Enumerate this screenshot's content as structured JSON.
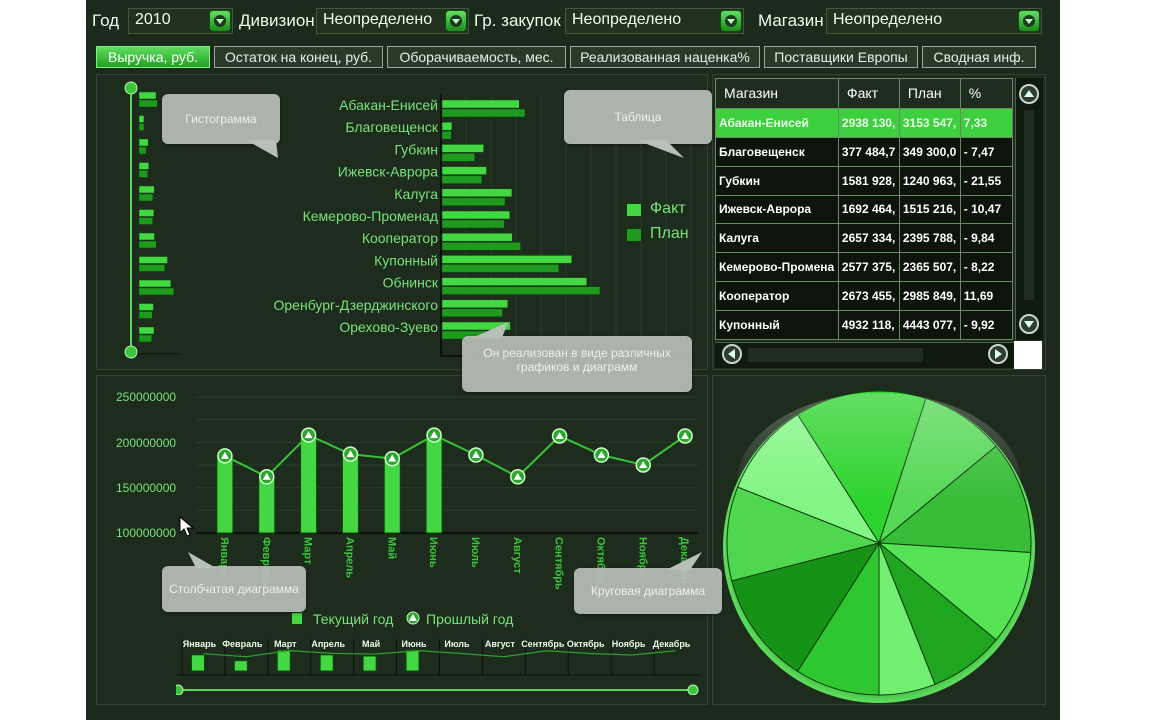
{
  "filters": {
    "year_label": "Год",
    "year_value": "2010",
    "division_label": "Дивизион",
    "division_value": "Неопределено",
    "group_label": "Гр. закупок",
    "group_value": "Неопределено",
    "store_label": "Магазин",
    "store_value": "Неопределено"
  },
  "tabs": [
    {
      "label": "Выручка, руб.",
      "active": true
    },
    {
      "label": "Остаток на конец, руб."
    },
    {
      "label": "Оборачиваемость, мес."
    },
    {
      "label": "Реализованная наценка%"
    },
    {
      "label": "Поставщики Европы"
    },
    {
      "label": "Сводная инф."
    }
  ],
  "callouts": {
    "histogram": "Гистограмма",
    "table": "Таблица",
    "implemented": "Он реализован в виде различных графиков и диаграмм",
    "bar_chart": "Столбчатая диаграмма",
    "pie_chart": "Круговая диаграмма"
  },
  "histogram_legend": {
    "fact": "Факт",
    "plan": "План"
  },
  "colors": {
    "fact": "#43d843",
    "plan": "#1f9a1f",
    "text_green": "#79e279"
  },
  "table": {
    "headers": [
      "Магазин",
      "Факт",
      "План",
      "%"
    ],
    "rows": [
      [
        "Абакан-Енисей",
        "2938 130,",
        "3153 547,",
        "7,33"
      ],
      [
        "Благовещенск",
        "377 484,7",
        "349 300,0",
        "- 7,47"
      ],
      [
        "Губкин",
        "1581 928,",
        "1240 963,",
        "- 21,55"
      ],
      [
        "Ижевск-Аврора",
        "1692 464,",
        "1515 216,",
        "- 10,47"
      ],
      [
        "Калуга",
        "2657 334,",
        "2395 788,",
        "- 9,84"
      ],
      [
        "Кемерово-Промена",
        "2577 375,",
        "2365 507,",
        "- 8,22"
      ],
      [
        "Кооператор",
        "2673 455,",
        "2985 849,",
        "11,69"
      ],
      [
        "Купонный",
        "4932 118,",
        "4443 077,",
        "- 9,92"
      ]
    ]
  },
  "chart_data": [
    {
      "type": "bar",
      "orientation": "horizontal",
      "categories": [
        "Абакан-Енисей",
        "Благовещенск",
        "Губкин",
        "Ижевск-Аврора",
        "Калуга",
        "Кемерово-Променад",
        "Кооператор",
        "Купонный",
        "Обнинск",
        "Оренбург-Дзерджинского",
        "Орехово-Зуево"
      ],
      "series": [
        {
          "name": "Факт",
          "values": [
            2938130,
            377485,
            1581928,
            1692464,
            2657334,
            2577375,
            2673455,
            4932118,
            5500000,
            2500000,
            2600000
          ]
        },
        {
          "name": "План",
          "values": [
            3153547,
            349300,
            1240963,
            1515216,
            2395788,
            2365507,
            2985849,
            4443077,
            6000000,
            2300000,
            2200000
          ]
        }
      ],
      "xlim": [
        0,
        9500000
      ]
    },
    {
      "type": "bar",
      "categories": [
        "Январь",
        "Февраль",
        "Март",
        "Апрель",
        "Май",
        "Июнь",
        "Июль",
        "Август",
        "Сентябрь",
        "Октябрь",
        "Ноябрь",
        "Декабрь"
      ],
      "series": [
        {
          "name": "Текущий год",
          "type": "bar",
          "values": [
            185000000,
            160000000,
            205000000,
            185000000,
            180000000,
            205000000,
            null,
            null,
            null,
            null,
            null,
            null
          ]
        },
        {
          "name": "Прошлый год",
          "type": "line",
          "values": [
            185000000,
            162000000,
            208000000,
            187000000,
            182000000,
            208000000,
            186000000,
            162000000,
            207000000,
            186000000,
            175000000,
            207000000
          ]
        }
      ],
      "y_ticks": [
        "250000000",
        "200000000",
        "150000000",
        "100000000"
      ],
      "ylim": [
        100000000,
        250000000
      ]
    },
    {
      "type": "pie",
      "values": [
        14,
        9,
        12,
        10,
        8,
        6,
        9,
        12,
        10,
        10
      ],
      "colors": [
        "#2fd32f",
        "#56d856",
        "#38bd38",
        "#56e356",
        "#1fa51f",
        "#72ee72",
        "#2fc72f",
        "#169216",
        "#4fd74f",
        "#82f582"
      ]
    }
  ],
  "mini_months": [
    "Январь",
    "Февраль",
    "Март",
    "Апрель",
    "Май",
    "Июнь",
    "Июль",
    "Август",
    "Сентябрь",
    "Октябрь",
    "Ноябрь",
    "Декабрь"
  ]
}
